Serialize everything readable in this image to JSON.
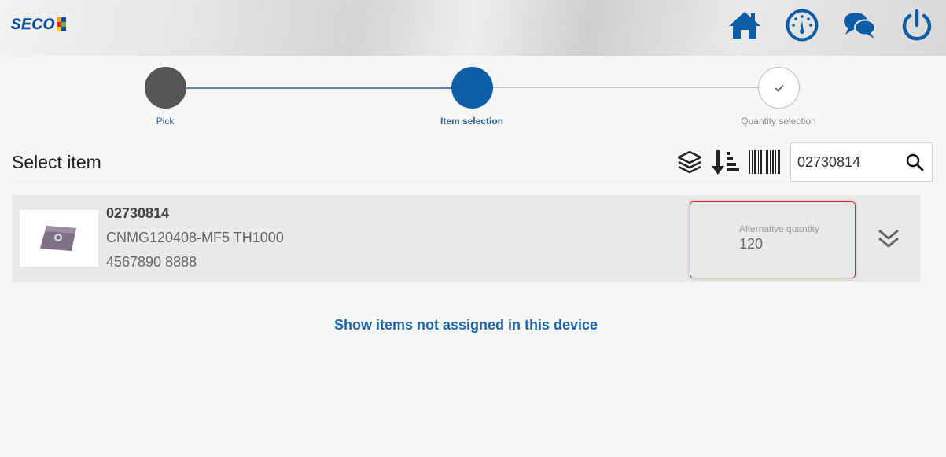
{
  "header": {
    "logo_text": "SECO",
    "logo_colors": [
      "#f3a01f",
      "#0b4f9c",
      "#e3262c",
      "#6ab33e",
      "#ffd400",
      "#0b4f9c"
    ],
    "icons": [
      "home-icon",
      "dashboard-icon",
      "chat-icon",
      "power-icon"
    ],
    "icon_color": "#0d5ea6"
  },
  "stepper": {
    "steps": [
      {
        "label": "Pick",
        "state": "done",
        "color": "#555555"
      },
      {
        "label": "Item selection",
        "state": "active",
        "color": "#0d5ea6"
      },
      {
        "label": "Quantity selection",
        "state": "pending",
        "color": "#ffffff"
      }
    ]
  },
  "page": {
    "title": "Select item",
    "tools": [
      "layers-icon",
      "sort-icon",
      "barcode-icon"
    ]
  },
  "search": {
    "value": "02730814",
    "icon": "search-icon"
  },
  "item": {
    "code": "02730814",
    "description": "CNMG120408-MF5 TH1000",
    "barcode": "4567890 8888",
    "alt_label": "Alternative quantity",
    "alt_value": "120",
    "expand_icon": "double-chevron-down-icon"
  },
  "link": {
    "text": "Show items not assigned in this device"
  }
}
